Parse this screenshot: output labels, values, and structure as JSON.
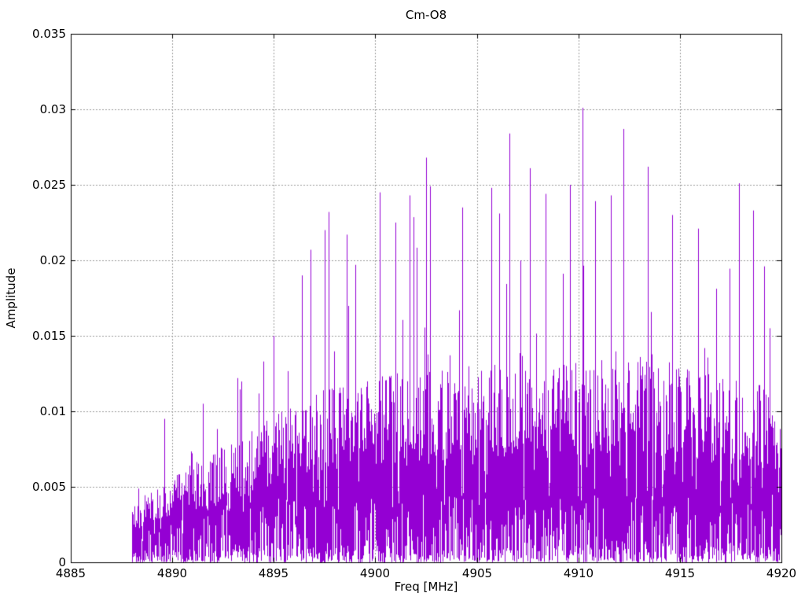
{
  "figure": {
    "title": "Cm-O8",
    "x_label": "Freq [MHz]",
    "y_label": "Amplitude"
  },
  "chart_data": {
    "type": "line",
    "title": "Cm-O8",
    "xlabel": "Freq [MHz]",
    "ylabel": "Amplitude",
    "xlim": [
      4885,
      4920
    ],
    "ylim": [
      0,
      0.035
    ],
    "x_ticks": [
      4885,
      4890,
      4895,
      4900,
      4905,
      4910,
      4915,
      4920
    ],
    "x_tick_labels": [
      "4885",
      "4890",
      "4895",
      "4900",
      "4905",
      "4910",
      "4915",
      "4920"
    ],
    "y_ticks": [
      0,
      0.005,
      0.01,
      0.015,
      0.02,
      0.025,
      0.03,
      0.035
    ],
    "y_tick_labels": [
      "0",
      "0.005",
      "0.01",
      "0.015",
      "0.02",
      "0.025",
      "0.03",
      "0.035"
    ],
    "grid": true,
    "grid_style": "dotted",
    "legend": false,
    "series_color": "#9400d3",
    "grid_color": "#9c9c9c",
    "axis_color": "#000000",
    "background": "#ffffff",
    "description": "Dense noisy amplitude spectrum; signal begins near 4888 MHz, rises steadily to a broad plateau (~0.004-0.014 dense band) from ~4898 to 4920 MHz with sharp spikes up to 0.030.",
    "data_start_freq": 4888.0,
    "data_end_freq": 4920.0,
    "noise_floor_max": 0.0045,
    "envelope": [
      {
        "freq": 4888.0,
        "mass_top": 0.0038,
        "spike_max": 0.0056
      },
      {
        "freq": 4889.0,
        "mass_top": 0.0046,
        "spike_max": 0.0075
      },
      {
        "freq": 4890.0,
        "mass_top": 0.0055,
        "spike_max": 0.0095
      },
      {
        "freq": 4891.0,
        "mass_top": 0.0062,
        "spike_max": 0.0105
      },
      {
        "freq": 4892.0,
        "mass_top": 0.007,
        "spike_max": 0.0108
      },
      {
        "freq": 4893.0,
        "mass_top": 0.0078,
        "spike_max": 0.0122
      },
      {
        "freq": 4894.0,
        "mass_top": 0.0085,
        "spike_max": 0.0135
      },
      {
        "freq": 4895.0,
        "mass_top": 0.0092,
        "spike_max": 0.0152
      },
      {
        "freq": 4896.0,
        "mass_top": 0.01,
        "spike_max": 0.019
      },
      {
        "freq": 4897.0,
        "mass_top": 0.0108,
        "spike_max": 0.0215
      },
      {
        "freq": 4898.0,
        "mass_top": 0.011,
        "spike_max": 0.02
      },
      {
        "freq": 4899.0,
        "mass_top": 0.0112,
        "spike_max": 0.0205
      },
      {
        "freq": 4900.0,
        "mass_top": 0.0118,
        "spike_max": 0.022
      },
      {
        "freq": 4901.0,
        "mass_top": 0.012,
        "spike_max": 0.023
      },
      {
        "freq": 4902.0,
        "mass_top": 0.0122,
        "spike_max": 0.0235
      },
      {
        "freq": 4903.0,
        "mass_top": 0.0122,
        "spike_max": 0.024
      },
      {
        "freq": 4904.0,
        "mass_top": 0.0124,
        "spike_max": 0.023
      },
      {
        "freq": 4905.0,
        "mass_top": 0.0126,
        "spike_max": 0.024
      },
      {
        "freq": 4906.0,
        "mass_top": 0.0128,
        "spike_max": 0.025
      },
      {
        "freq": 4907.0,
        "mass_top": 0.0126,
        "spike_max": 0.0245
      },
      {
        "freq": 4908.0,
        "mass_top": 0.0124,
        "spike_max": 0.024
      },
      {
        "freq": 4909.0,
        "mass_top": 0.0124,
        "spike_max": 0.0245
      },
      {
        "freq": 4910.0,
        "mass_top": 0.0128,
        "spike_max": 0.025
      },
      {
        "freq": 4911.0,
        "mass_top": 0.0128,
        "spike_max": 0.024
      },
      {
        "freq": 4912.0,
        "mass_top": 0.013,
        "spike_max": 0.025
      },
      {
        "freq": 4913.0,
        "mass_top": 0.0132,
        "spike_max": 0.025
      },
      {
        "freq": 4914.0,
        "mass_top": 0.0128,
        "spike_max": 0.0235
      },
      {
        "freq": 4915.0,
        "mass_top": 0.0124,
        "spike_max": 0.0225
      },
      {
        "freq": 4916.0,
        "mass_top": 0.012,
        "spike_max": 0.02
      },
      {
        "freq": 4917.0,
        "mass_top": 0.0118,
        "spike_max": 0.0225
      },
      {
        "freq": 4918.0,
        "mass_top": 0.0115,
        "spike_max": 0.0235
      },
      {
        "freq": 4919.0,
        "mass_top": 0.0112,
        "spike_max": 0.0215
      },
      {
        "freq": 4920.0,
        "mass_top": 0.01,
        "spike_max": 0.013
      }
    ],
    "notable_peaks": [
      {
        "freq": 4889.6,
        "amp": 0.0095
      },
      {
        "freq": 4891.5,
        "amp": 0.0105
      },
      {
        "freq": 4893.2,
        "amp": 0.0122
      },
      {
        "freq": 4894.5,
        "amp": 0.0133
      },
      {
        "freq": 4895.0,
        "amp": 0.015
      },
      {
        "freq": 4896.4,
        "amp": 0.019
      },
      {
        "freq": 4896.8,
        "amp": 0.0207
      },
      {
        "freq": 4897.5,
        "amp": 0.022
      },
      {
        "freq": 4897.7,
        "amp": 0.0232
      },
      {
        "freq": 4898.6,
        "amp": 0.0217
      },
      {
        "freq": 4899.0,
        "amp": 0.0197
      },
      {
        "freq": 4900.2,
        "amp": 0.0245
      },
      {
        "freq": 4901.0,
        "amp": 0.0225
      },
      {
        "freq": 4901.7,
        "amp": 0.0243
      },
      {
        "freq": 4902.5,
        "amp": 0.0268
      },
      {
        "freq": 4902.7,
        "amp": 0.0249
      },
      {
        "freq": 4904.3,
        "amp": 0.0235
      },
      {
        "freq": 4905.7,
        "amp": 0.0248
      },
      {
        "freq": 4906.1,
        "amp": 0.0231
      },
      {
        "freq": 4906.6,
        "amp": 0.0284
      },
      {
        "freq": 4907.6,
        "amp": 0.0261
      },
      {
        "freq": 4908.4,
        "amp": 0.0244
      },
      {
        "freq": 4909.6,
        "amp": 0.025
      },
      {
        "freq": 4910.2,
        "amp": 0.0301
      },
      {
        "freq": 4911.6,
        "amp": 0.0243
      },
      {
        "freq": 4912.2,
        "amp": 0.0287
      },
      {
        "freq": 4913.4,
        "amp": 0.0262
      },
      {
        "freq": 4914.6,
        "amp": 0.023
      },
      {
        "freq": 4915.9,
        "amp": 0.0221
      },
      {
        "freq": 4917.9,
        "amp": 0.0251
      },
      {
        "freq": 4918.6,
        "amp": 0.0233
      },
      {
        "freq": 4919.4,
        "amp": 0.0155
      }
    ],
    "max_peak": {
      "freq": 4910.2,
      "amp": 0.0301
    }
  }
}
